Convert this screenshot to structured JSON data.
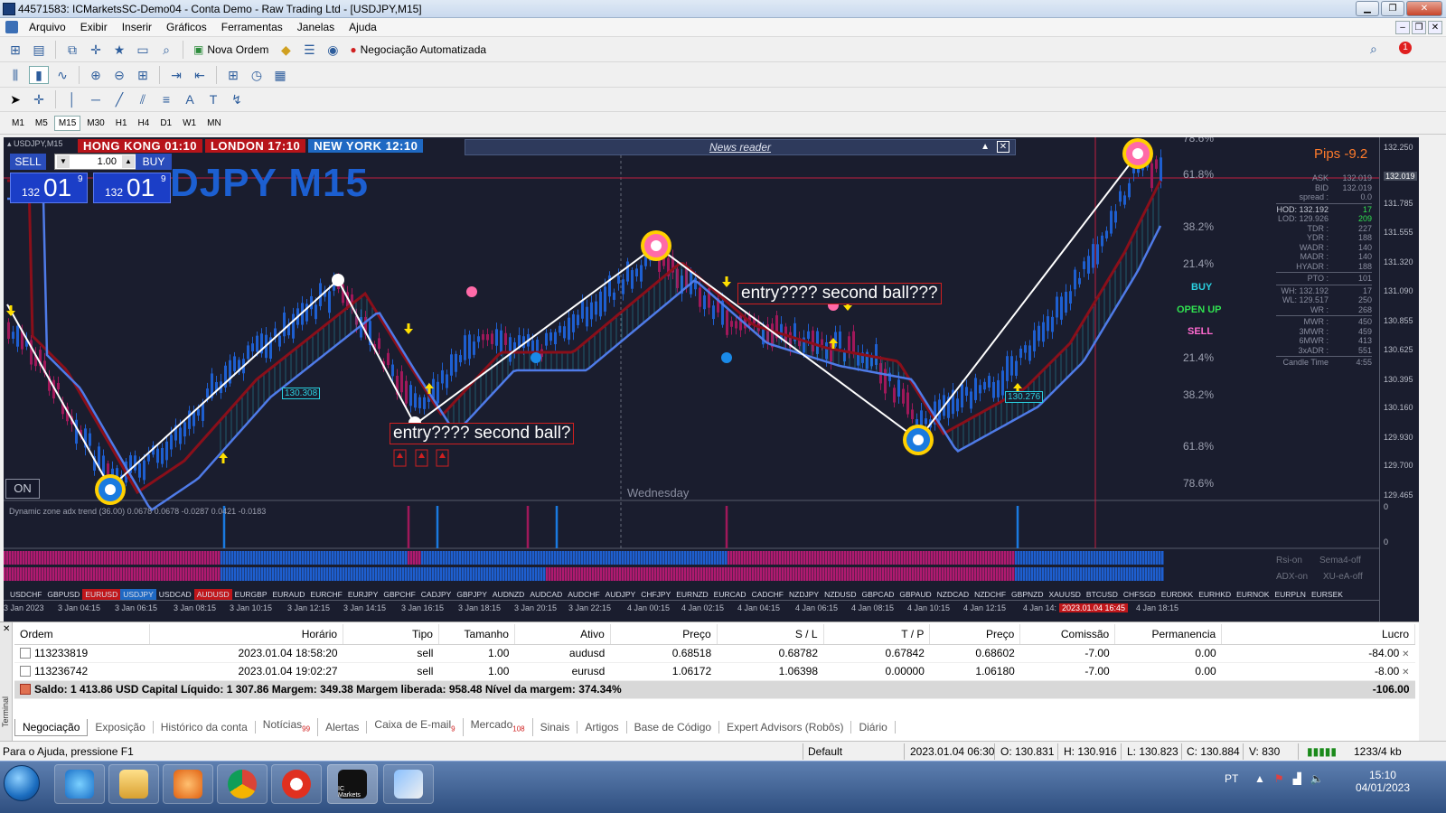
{
  "window": {
    "title": "44571583: ICMarketsSC-Demo04 - Conta Demo - Raw Trading Ltd - [USDJPY,M15]"
  },
  "menu": [
    "Arquivo",
    "Exibir",
    "Inserir",
    "Gráficos",
    "Ferramentas",
    "Janelas",
    "Ajuda"
  ],
  "toolbar": {
    "new_order": "Nova Ordem",
    "auto_trading": "Negociação Automatizada"
  },
  "timeframes": [
    "M1",
    "M5",
    "M15",
    "M30",
    "H1",
    "H4",
    "D1",
    "W1",
    "MN"
  ],
  "chart": {
    "symbol_label": "USDJPY,M15",
    "watermark": "DJPY M15",
    "sessions": {
      "hk": "HONG KONG 01:10",
      "london": "LONDON  17:10",
      "ny": "NEW YORK 12:10"
    },
    "news_reader": "News reader",
    "oneclick": {
      "sell": "SELL",
      "buy": "BUY",
      "lot": "1.00",
      "sell_small": "132",
      "sell_big": "01",
      "sell_sup": "9",
      "buy_small": "132",
      "buy_big": "01",
      "buy_sup": "9"
    },
    "pips": "Pips -9.2",
    "on_button": "ON",
    "weekday": "Wednesday",
    "annotation1": "entry???? second ball?",
    "annotation2": "entry???? second ball???",
    "price_box1": "130.308",
    "price_box2": "130.276",
    "indicator_label": "Dynamic zone adx trend (36.00) 0.0678 0.0678 -0.0287 0.0421 -0.0183",
    "fib_right": [
      "78.6%",
      "61.8%",
      "38.2%",
      "21.4%",
      "21.4%",
      "38.2%",
      "61.8%",
      "78.6%"
    ],
    "signals": {
      "buy": "BUY",
      "open": "OPEN UP",
      "sell": "SELL"
    },
    "panel": [
      {
        "l": "ASK",
        "v": "132.019"
      },
      {
        "l": "BID",
        "v": "132.019"
      },
      {
        "l": "spread :",
        "v": "0.0"
      },
      {
        "l": "HOD: 132.192",
        "v": "17"
      },
      {
        "l": "LOD: 129.926",
        "v": "209"
      },
      {
        "l": "TDR :",
        "v": "227"
      },
      {
        "l": "YDR :",
        "v": "188"
      },
      {
        "l": "WADR :",
        "v": "140"
      },
      {
        "l": "MADR :",
        "v": "140"
      },
      {
        "l": "HYADR :",
        "v": "188"
      },
      {
        "l": "PTO :",
        "v": "101"
      },
      {
        "l": "WH: 132.192",
        "v": "17"
      },
      {
        "l": "WL: 129.517",
        "v": "250"
      },
      {
        "l": "WR :",
        "v": "268"
      },
      {
        "l": "MWR :",
        "v": "450"
      },
      {
        "l": "3MWR :",
        "v": "459"
      },
      {
        "l": "6MWR :",
        "v": "413"
      },
      {
        "l": "3xADR :",
        "v": "551"
      },
      {
        "l": "Candle Time",
        "v": "4:55"
      }
    ],
    "y_labels": [
      "132.250",
      "132.019",
      "131.785",
      "131.555",
      "131.320",
      "131.090",
      "130.855",
      "130.625",
      "130.395",
      "130.160",
      "129.930",
      "129.700",
      "129.465"
    ],
    "ind_y": [
      "0",
      "0"
    ],
    "rsi_label": "Rsi-on",
    "sema_label": "Sema4-off",
    "adx_label": "ADX-on",
    "xu_label": "XU-eA-off",
    "symbols": [
      "USDCHF",
      "GBPUSD",
      "EURUSD",
      "USDJPY",
      "USDCAD",
      "AUDUSD",
      "EURGBP",
      "EURAUD",
      "EURCHF",
      "EURJPY",
      "GBPCHF",
      "CADJPY",
      "GBPJPY",
      "AUDNZD",
      "AUDCAD",
      "AUDCHF",
      "AUDJPY",
      "CHFJPY",
      "EURNZD",
      "EURCAD",
      "CADCHF",
      "NZDJPY",
      "NZDUSD",
      "GBPCAD",
      "GBPAUD",
      "NZDCAD",
      "NZDCHF",
      "GBPNZD",
      "XAUUSD",
      "BTCUSD",
      "CHFSGD",
      "EURDKK",
      "EURHKD",
      "EURNOK",
      "EURPLN",
      "EURSEK"
    ],
    "x_labels": [
      "3 Jan 2023",
      "3 Jan 04:15",
      "3 Jan 06:15",
      "3 Jan 08:15",
      "3 Jan 10:15",
      "3 Jan 12:15",
      "3 Jan 14:15",
      "3 Jan 16:15",
      "3 Jan 18:15",
      "3 Jan 20:15",
      "3 Jan 22:15",
      "4 Jan 00:15",
      "4 Jan 02:15",
      "4 Jan 04:15",
      "4 Jan 06:15",
      "4 Jan 08:15",
      "4 Jan 10:15",
      "4 Jan 12:15",
      "4 Jan 14:",
      "2023.01.04 16:45",
      "4 Jan 18:15"
    ]
  },
  "orders": {
    "headers": [
      "Ordem",
      "Horário",
      "Tipo",
      "Tamanho",
      "Ativo",
      "Preço",
      "S / L",
      "T / P",
      "Preço",
      "Comissão",
      "Permanencia",
      "Lucro"
    ],
    "rows": [
      [
        "113233819",
        "2023.01.04 18:58:20",
        "sell",
        "1.00",
        "audusd",
        "0.68518",
        "0.68782",
        "0.67842",
        "0.68602",
        "-7.00",
        "0.00",
        "-84.00"
      ],
      [
        "113236742",
        "2023.01.04 19:02:27",
        "sell",
        "1.00",
        "eurusd",
        "1.06172",
        "1.06398",
        "0.00000",
        "1.06180",
        "-7.00",
        "0.00",
        "-8.00"
      ]
    ],
    "balance": "Saldo: 1 413.86 USD  Capital Líquido: 1 307.86  Margem: 349.38  Margem liberada: 958.48  Nível da margem: 374.34%",
    "total": "-106.00"
  },
  "terminal": {
    "side_label": "Terminal",
    "tabs": [
      {
        "label": "Negociação",
        "badge": ""
      },
      {
        "label": "Exposição",
        "badge": ""
      },
      {
        "label": "Histórico da conta",
        "badge": ""
      },
      {
        "label": "Notícias",
        "badge": "99"
      },
      {
        "label": "Alertas",
        "badge": ""
      },
      {
        "label": "Caixa de E-mail",
        "badge": "9"
      },
      {
        "label": "Mercado",
        "badge": "108"
      },
      {
        "label": "Sinais",
        "badge": ""
      },
      {
        "label": "Artigos",
        "badge": ""
      },
      {
        "label": "Base de Código",
        "badge": ""
      },
      {
        "label": "Expert Advisors (Robôs)",
        "badge": ""
      },
      {
        "label": "Diário",
        "badge": ""
      }
    ]
  },
  "status": {
    "help": "Para o Ajuda, pressione F1",
    "profile": "Default",
    "datetime": "2023.01.04 06:30",
    "open": "O: 130.831",
    "high": "H: 130.916",
    "low": "L: 130.823",
    "close": "C: 130.884",
    "volume": "V: 830",
    "traffic": "1233/4 kb"
  },
  "taskbar": {
    "lang": "PT",
    "time": "15:10",
    "date": "04/01/2023",
    "mt_label": "IC Markets"
  },
  "colors": {
    "chart_bg": "#1a1d2e",
    "bull": "#1e5fd0",
    "bear": "#a0185a",
    "ma_red": "#8a0f1a",
    "ma_blue": "#4f7be8",
    "zigzag": "#ffffff"
  }
}
